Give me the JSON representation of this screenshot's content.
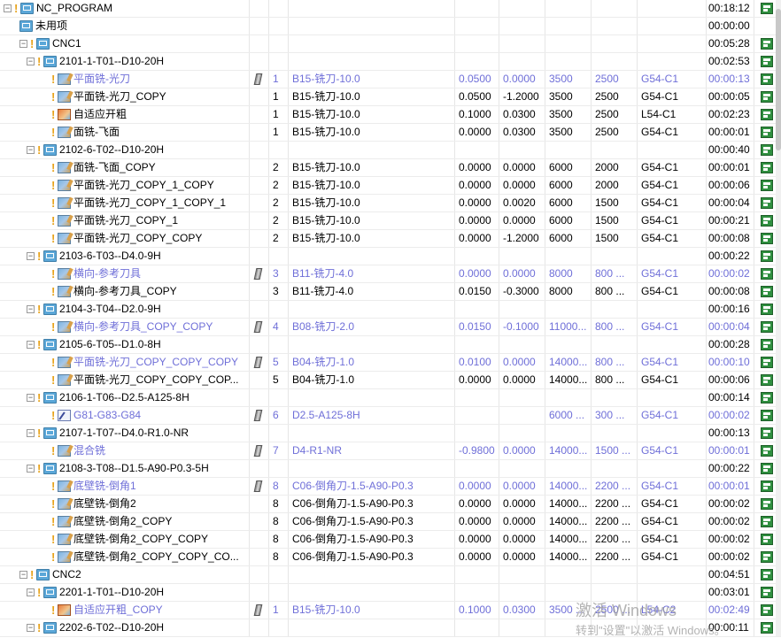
{
  "tree": [
    {
      "name": "NC_PROGRAM",
      "level": 0,
      "icon": "folder-icon",
      "expand": "minus",
      "warn": true,
      "time": "00:18:12",
      "check": true
    },
    {
      "name": "未用项",
      "level": 1,
      "icon": "folder-icon",
      "expand": "",
      "warn": false,
      "time": "00:00:00",
      "check": false
    },
    {
      "name": "CNC1",
      "level": 1,
      "icon": "folder-icon",
      "expand": "minus",
      "warn": true,
      "time": "00:05:28",
      "check": true
    },
    {
      "name": "2101-1-T01--D10-20H",
      "level": 2,
      "icon": "folder-icon",
      "expand": "minus",
      "warn": true,
      "time": "00:02:53",
      "check": true
    },
    {
      "name": "平面铣-光刀",
      "level": 3,
      "icon": "mill-op-icon",
      "warn": true,
      "lavender": true,
      "tool": true,
      "num": "1",
      "tname": "B15-铣刀-10.0",
      "v1": "0.0500",
      "v2": "0.0000",
      "sp": "3500",
      "fd": "2500",
      "wcs": "G54-C1",
      "time": "00:00:13",
      "check": true
    },
    {
      "name": "平面铣-光刀_COPY",
      "level": 3,
      "icon": "mill-op-icon",
      "warn": true,
      "num": "1",
      "tname": "B15-铣刀-10.0",
      "v1": "0.0500",
      "v2": "-1.2000",
      "sp": "3500",
      "fd": "2500",
      "wcs": "G54-C1",
      "time": "00:00:05",
      "check": true
    },
    {
      "name": "自适应开粗",
      "level": 3,
      "icon": "adaptive-op-icon",
      "warn": true,
      "num": "1",
      "tname": "B15-铣刀-10.0",
      "v1": "0.1000",
      "v2": "0.0300",
      "sp": "3500",
      "fd": "2500",
      "wcs": "L54-C1",
      "time": "00:02:23",
      "check": true
    },
    {
      "name": "面铣-飞面",
      "level": 3,
      "icon": "mill-op-icon",
      "warn": true,
      "num": "1",
      "tname": "B15-铣刀-10.0",
      "v1": "0.0000",
      "v2": "0.0300",
      "sp": "3500",
      "fd": "2500",
      "wcs": "G54-C1",
      "time": "00:00:01",
      "check": true
    },
    {
      "name": "2102-6-T02--D10-20H",
      "level": 2,
      "icon": "folder-icon",
      "expand": "minus",
      "warn": true,
      "time": "00:00:40",
      "check": true
    },
    {
      "name": "面铣-飞面_COPY",
      "level": 3,
      "icon": "mill-op-icon",
      "warn": true,
      "num": "2",
      "tname": "B15-铣刀-10.0",
      "v1": "0.0000",
      "v2": "0.0000",
      "sp": "6000",
      "fd": "2000",
      "wcs": "G54-C1",
      "time": "00:00:01",
      "check": true
    },
    {
      "name": "平面铣-光刀_COPY_1_COPY",
      "level": 3,
      "icon": "mill-op-icon",
      "warn": true,
      "num": "2",
      "tname": "B15-铣刀-10.0",
      "v1": "0.0000",
      "v2": "0.0000",
      "sp": "6000",
      "fd": "2000",
      "wcs": "G54-C1",
      "time": "00:00:06",
      "check": true
    },
    {
      "name": "平面铣-光刀_COPY_1_COPY_1",
      "level": 3,
      "icon": "mill-op-icon",
      "warn": true,
      "num": "2",
      "tname": "B15-铣刀-10.0",
      "v1": "0.0000",
      "v2": "0.0020",
      "sp": "6000",
      "fd": "1500",
      "wcs": "G54-C1",
      "time": "00:00:04",
      "check": true
    },
    {
      "name": "平面铣-光刀_COPY_1",
      "level": 3,
      "icon": "mill-op-icon",
      "warn": true,
      "num": "2",
      "tname": "B15-铣刀-10.0",
      "v1": "0.0000",
      "v2": "0.0000",
      "sp": "6000",
      "fd": "1500",
      "wcs": "G54-C1",
      "time": "00:00:21",
      "check": true
    },
    {
      "name": "平面铣-光刀_COPY_COPY",
      "level": 3,
      "icon": "mill-op-icon",
      "warn": true,
      "num": "2",
      "tname": "B15-铣刀-10.0",
      "v1": "0.0000",
      "v2": "-1.2000",
      "sp": "6000",
      "fd": "1500",
      "wcs": "G54-C1",
      "time": "00:00:08",
      "check": true
    },
    {
      "name": "2103-6-T03--D4.0-9H",
      "level": 2,
      "icon": "folder-icon",
      "expand": "minus",
      "warn": true,
      "time": "00:00:22",
      "check": true
    },
    {
      "name": "横向-参考刀具",
      "level": 3,
      "icon": "mill-op-icon",
      "warn": true,
      "lavender": true,
      "tool": true,
      "num": "3",
      "tname": "B11-铣刀-4.0",
      "v1": "0.0000",
      "v2": "0.0000",
      "sp": "8000",
      "fd": "800 ...",
      "wcs": "G54-C1",
      "time": "00:00:02",
      "check": true
    },
    {
      "name": "横向-参考刀具_COPY",
      "level": 3,
      "icon": "mill-op-icon",
      "warn": true,
      "num": "3",
      "tname": "B11-铣刀-4.0",
      "v1": "0.0150",
      "v2": "-0.3000",
      "sp": "8000",
      "fd": "800 ...",
      "wcs": "G54-C1",
      "time": "00:00:08",
      "check": true
    },
    {
      "name": "2104-3-T04--D2.0-9H",
      "level": 2,
      "icon": "folder-icon",
      "expand": "minus",
      "warn": true,
      "time": "00:00:16",
      "check": true
    },
    {
      "name": "横向-参考刀具_COPY_COPY",
      "level": 3,
      "icon": "mill-op-icon",
      "warn": true,
      "lavender": true,
      "tool": true,
      "num": "4",
      "tname": "B08-铣刀-2.0",
      "v1": "0.0150",
      "v2": "-0.1000",
      "sp": "11000...",
      "fd": "800 ...",
      "wcs": "G54-C1",
      "time": "00:00:04",
      "check": true
    },
    {
      "name": "2105-6-T05--D1.0-8H",
      "level": 2,
      "icon": "folder-icon",
      "expand": "minus",
      "warn": true,
      "time": "00:00:28",
      "check": true
    },
    {
      "name": "平面铣-光刀_COPY_COPY_COPY",
      "level": 3,
      "icon": "mill-op-icon",
      "warn": true,
      "lavender": true,
      "tool": true,
      "num": "5",
      "tname": "B04-铣刀-1.0",
      "v1": "0.0100",
      "v2": "0.0000",
      "sp": "14000...",
      "fd": "800 ...",
      "wcs": "G54-C1",
      "time": "00:00:10",
      "check": true
    },
    {
      "name": "平面铣-光刀_COPY_COPY_COP...",
      "level": 3,
      "icon": "mill-op-icon",
      "warn": true,
      "num": "5",
      "tname": "B04-铣刀-1.0",
      "v1": "0.0000",
      "v2": "0.0000",
      "sp": "14000...",
      "fd": "800 ...",
      "wcs": "G54-C1",
      "time": "00:00:06",
      "check": true
    },
    {
      "name": "2106-1-T06--D2.5-A125-8H",
      "level": 2,
      "icon": "folder-icon",
      "expand": "minus",
      "warn": true,
      "time": "00:00:14",
      "check": true
    },
    {
      "name": "G81-G83-G84",
      "level": 3,
      "icon": "drill-op-icon",
      "warn": true,
      "lavender": true,
      "tool": true,
      "num": "6",
      "tname": "D2.5-A125-8H",
      "v1": "",
      "v2": "",
      "sp": "6000 ...",
      "fd": "300 ...",
      "wcs": "G54-C1",
      "time": "00:00:02",
      "check": true
    },
    {
      "name": "2107-1-T07--D4.0-R1.0-NR",
      "level": 2,
      "icon": "folder-icon",
      "expand": "minus",
      "warn": true,
      "time": "00:00:13",
      "check": true
    },
    {
      "name": "混合铣",
      "level": 3,
      "icon": "mill-op-icon",
      "warn": true,
      "lavender": true,
      "tool": true,
      "num": "7",
      "tname": "D4-R1-NR",
      "v1": "-0.9800",
      "v2": "0.0000",
      "sp": "14000...",
      "fd": "1500 ...",
      "wcs": "G54-C1",
      "time": "00:00:01",
      "check": true
    },
    {
      "name": "2108-3-T08--D1.5-A90-P0.3-5H",
      "level": 2,
      "icon": "folder-icon",
      "expand": "minus",
      "warn": true,
      "time": "00:00:22",
      "check": true
    },
    {
      "name": "底壁铣-倒角1",
      "level": 3,
      "icon": "mill-op-icon",
      "warn": true,
      "lavender": true,
      "tool": true,
      "num": "8",
      "tname": "C06-倒角刀-1.5-A90-P0.3",
      "v1": "0.0000",
      "v2": "0.0000",
      "sp": "14000...",
      "fd": "2200 ...",
      "wcs": "G54-C1",
      "time": "00:00:01",
      "check": true
    },
    {
      "name": "底壁铣-倒角2",
      "level": 3,
      "icon": "mill-op-icon",
      "warn": true,
      "num": "8",
      "tname": "C06-倒角刀-1.5-A90-P0.3",
      "v1": "0.0000",
      "v2": "0.0000",
      "sp": "14000...",
      "fd": "2200 ...",
      "wcs": "G54-C1",
      "time": "00:00:02",
      "check": true
    },
    {
      "name": "底壁铣-倒角2_COPY",
      "level": 3,
      "icon": "mill-op-icon",
      "warn": true,
      "num": "8",
      "tname": "C06-倒角刀-1.5-A90-P0.3",
      "v1": "0.0000",
      "v2": "0.0000",
      "sp": "14000...",
      "fd": "2200 ...",
      "wcs": "G54-C1",
      "time": "00:00:02",
      "check": true
    },
    {
      "name": "底壁铣-倒角2_COPY_COPY",
      "level": 3,
      "icon": "mill-op-icon",
      "warn": true,
      "num": "8",
      "tname": "C06-倒角刀-1.5-A90-P0.3",
      "v1": "0.0000",
      "v2": "0.0000",
      "sp": "14000...",
      "fd": "2200 ...",
      "wcs": "G54-C1",
      "time": "00:00:02",
      "check": true
    },
    {
      "name": "底壁铣-倒角2_COPY_COPY_CO...",
      "level": 3,
      "icon": "mill-op-icon",
      "warn": true,
      "num": "8",
      "tname": "C06-倒角刀-1.5-A90-P0.3",
      "v1": "0.0000",
      "v2": "0.0000",
      "sp": "14000...",
      "fd": "2200 ...",
      "wcs": "G54-C1",
      "time": "00:00:02",
      "check": true
    },
    {
      "name": "CNC2",
      "level": 1,
      "icon": "folder-icon",
      "expand": "minus",
      "warn": true,
      "time": "00:04:51",
      "check": true
    },
    {
      "name": "2201-1-T01--D10-20H",
      "level": 2,
      "icon": "folder-icon",
      "expand": "minus",
      "warn": true,
      "time": "00:03:01",
      "check": true
    },
    {
      "name": "自适应开粗_COPY",
      "level": 3,
      "icon": "adaptive-op-icon",
      "warn": true,
      "lavender": true,
      "tool": true,
      "num": "1",
      "tname": "B15-铣刀-10.0",
      "v1": "0.1000",
      "v2": "0.0300",
      "sp": "3500 ...",
      "fd": "2500 ...",
      "wcs": "L54-C2",
      "time": "00:02:49",
      "check": true
    },
    {
      "name": "2202-6-T02--D10-20H",
      "level": 2,
      "icon": "folder-icon",
      "expand": "minus",
      "warn": true,
      "time": "00:00:11",
      "check": true
    }
  ],
  "watermark": {
    "line1": "激活 Windows",
    "line2": "转到\"设置\"以激活 Windows。"
  }
}
